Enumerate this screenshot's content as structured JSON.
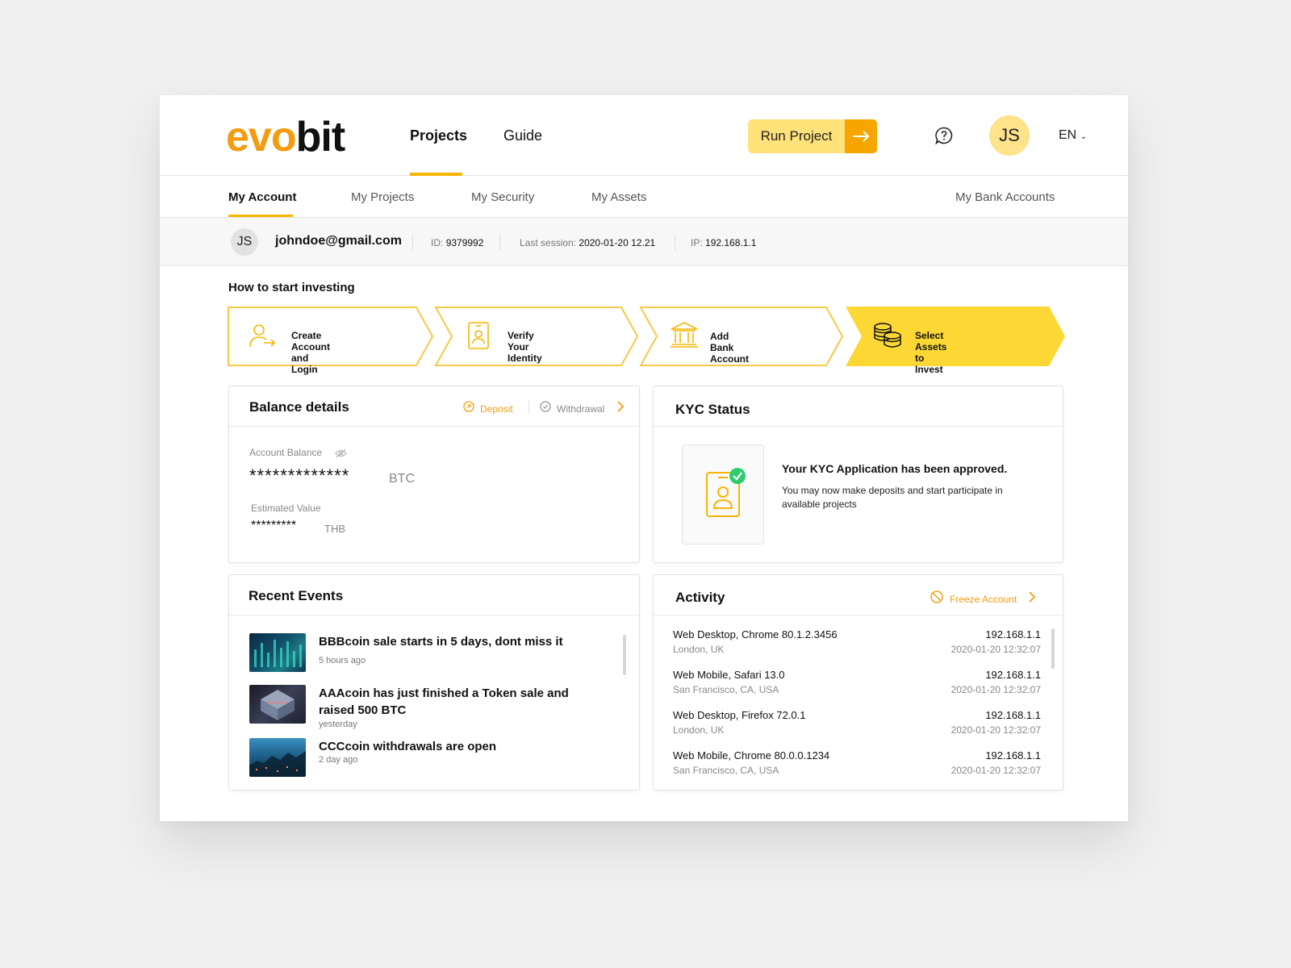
{
  "brand": {
    "logo_part1": "evo",
    "logo_part2": "bit",
    "accent": "#f7b500",
    "accent_dark": "#f39c12"
  },
  "header": {
    "nav": [
      {
        "label": "Projects",
        "active": true
      },
      {
        "label": "Guide",
        "active": false
      }
    ],
    "run_button": "Run Project",
    "help_icon": "question-bubble-icon",
    "avatar_initials": "JS",
    "language": "EN"
  },
  "subnav": {
    "items": [
      "My Account",
      "My Projects",
      "My Security",
      "My Assets"
    ],
    "right_item": "My Bank Accounts",
    "active": "My Account"
  },
  "user": {
    "initials": "JS",
    "email": "johndoe@gmail.com",
    "id_label": "ID:",
    "id_value": "9379992",
    "session_label": "Last session:",
    "session_value": "2020-01-20 12.21",
    "ip_label": "IP:",
    "ip_value": "192.168.1.1"
  },
  "howto": {
    "title": "How to start investing",
    "steps": [
      {
        "label": "Create Account and Login",
        "icon": "user-login-icon"
      },
      {
        "label": "Verify Your Identity",
        "icon": "id-card-icon"
      },
      {
        "label": "Add Bank Account",
        "icon": "bank-icon"
      },
      {
        "label": "Select Assets to Invest",
        "icon": "coins-icon",
        "active": true
      }
    ]
  },
  "balance": {
    "title": "Balance details",
    "deposit": "Deposit",
    "withdrawal": "Withdrawal",
    "account_balance_label": "Account Balance",
    "account_balance_value": "*************",
    "account_balance_unit": "BTC",
    "estimated_label": "Estimated Value",
    "estimated_value": "*********",
    "estimated_unit": "THB"
  },
  "kyc": {
    "title": "KYC Status",
    "status_title": "Your KYC Application has been approved.",
    "status_text": "You may now make deposits and start participate in available projects"
  },
  "events": {
    "title": "Recent Events",
    "items": [
      {
        "title": "BBBcoin sale starts in 5 days, dont miss it",
        "time": "5 hours ago"
      },
      {
        "title": "AAAcoin has just finished a Token sale and raised 500 BTC",
        "time": "yesterday"
      },
      {
        "title": "CCCcoin withdrawals are open",
        "time": "2 day ago"
      }
    ]
  },
  "activity": {
    "title": "Activity",
    "freeze": "Freeze Account",
    "items": [
      {
        "device": "Web Desktop, Chrome 80.1.2.3456",
        "location": "London, UK",
        "ip": "192.168.1.1",
        "time": "2020-01-20 12:32:07"
      },
      {
        "device": "Web Mobile, Safari 13.0",
        "location": "San Francisco, CA, USA",
        "ip": "192.168.1.1",
        "time": "2020-01-20 12:32:07"
      },
      {
        "device": "Web Desktop, Firefox 72.0.1",
        "location": "London, UK",
        "ip": "192.168.1.1",
        "time": "2020-01-20 12:32:07"
      },
      {
        "device": "Web Mobile, Chrome 80.0.0.1234",
        "location": "San Francisco, CA, USA",
        "ip": "192.168.1.1",
        "time": "2020-01-20 12:32:07"
      }
    ]
  }
}
